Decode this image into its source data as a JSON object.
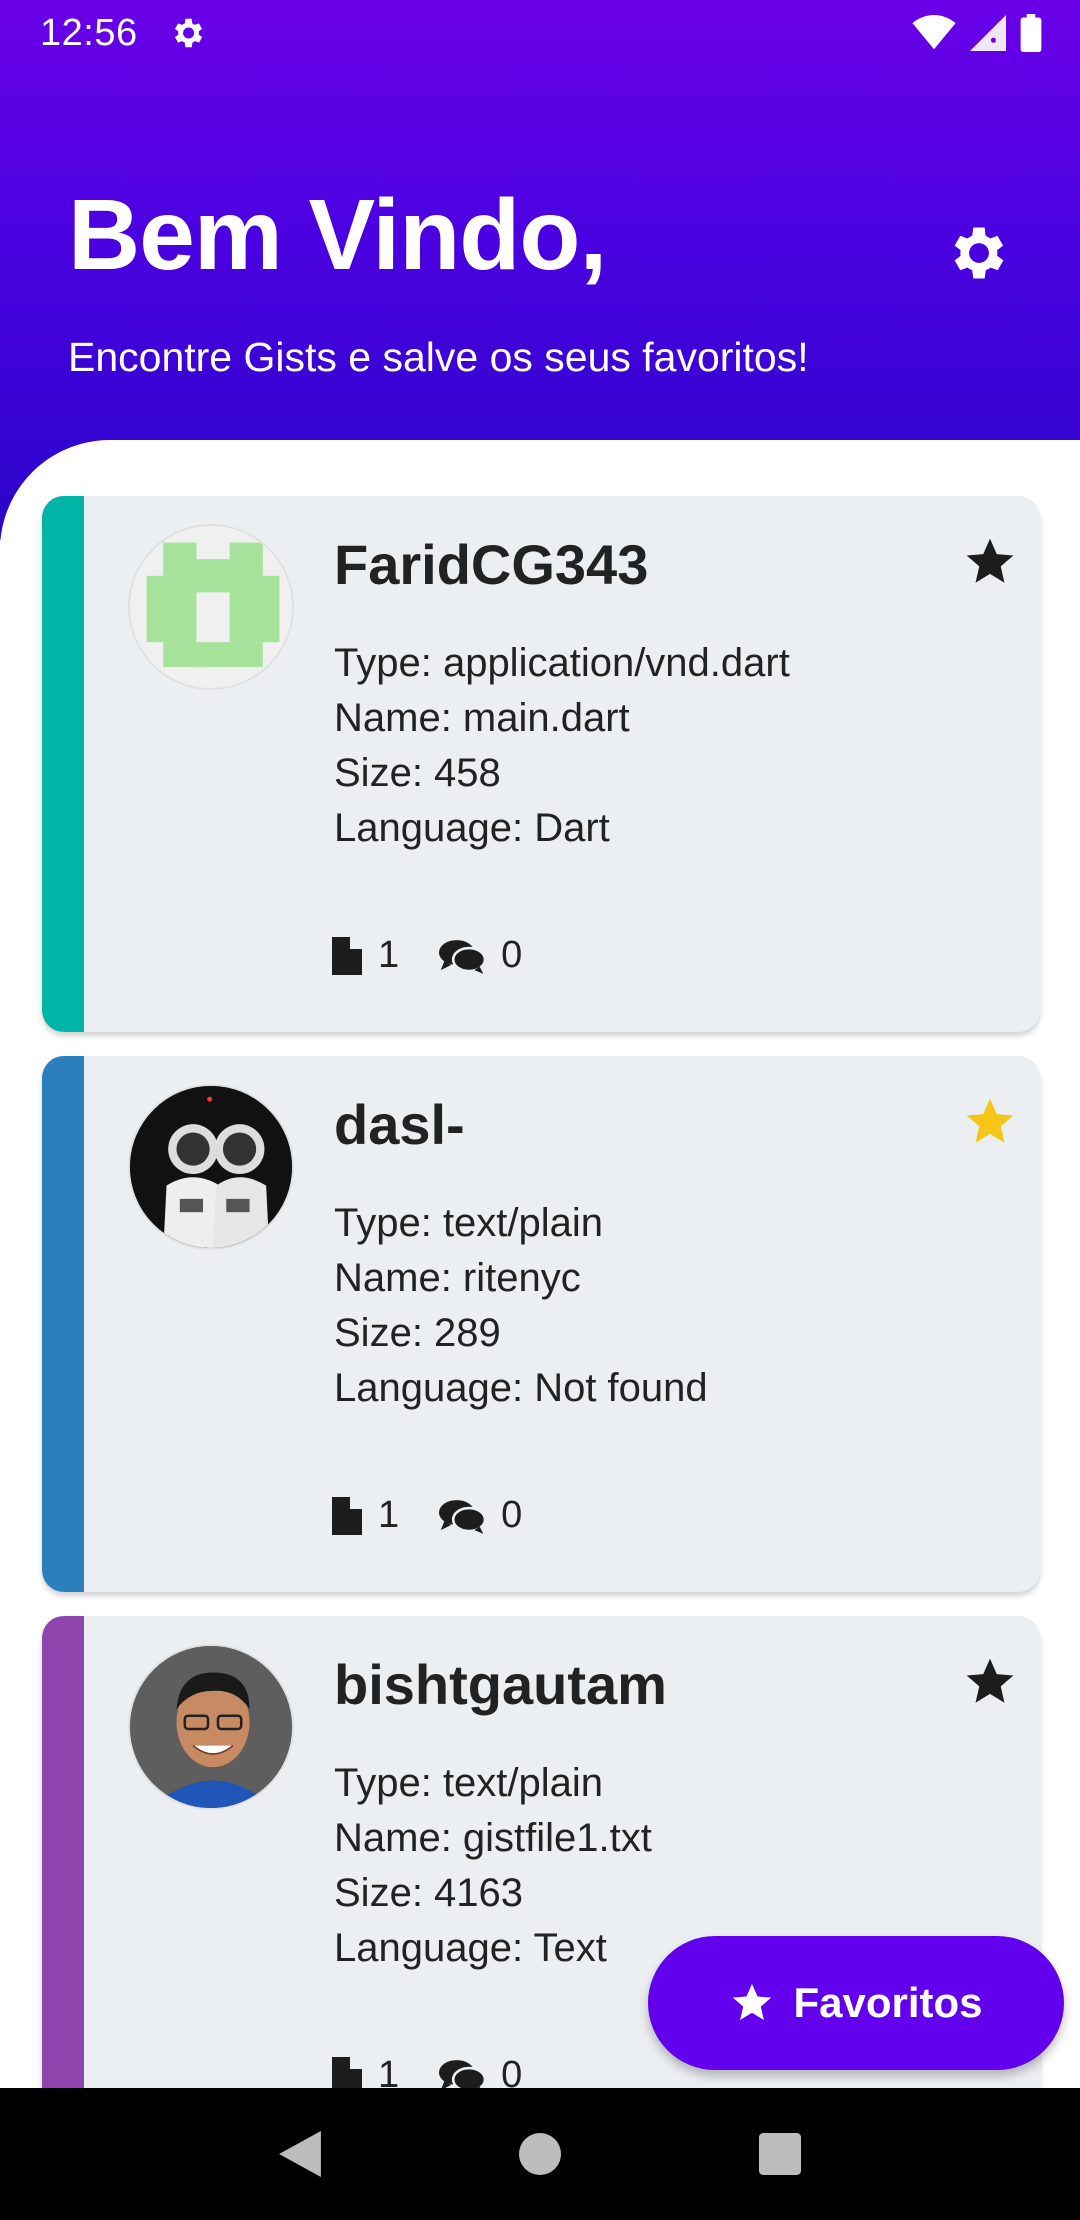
{
  "status_bar": {
    "time": "12:56",
    "icons": [
      "settings-icon",
      "wifi-icon",
      "signal-icon",
      "battery-icon"
    ]
  },
  "header": {
    "title": "Bem Vindo,",
    "subtitle": "Encontre Gists e salve os seus favoritos!",
    "settings_icon": "gear-icon"
  },
  "colors": {
    "header_top": "#6a00e8",
    "header_bottom": "#2a04c9",
    "card_background": "#eceff1",
    "favorite_star": "#f5c518",
    "fab": "#6200ee"
  },
  "gists": [
    {
      "username": "FaridCG343",
      "accent": "#00b4a6",
      "favorite": false,
      "type": "Type: application/vnd.dart",
      "name": "Name: main.dart",
      "size": "Size: 458",
      "language": "Language: Dart",
      "files": "1",
      "comments": "0"
    },
    {
      "username": "dasl-",
      "accent": "#2b7fbd",
      "favorite": true,
      "type": "Type: text/plain",
      "name": "Name: ritenyc",
      "size": "Size: 289",
      "language": "Language: Not found",
      "files": "1",
      "comments": "0"
    },
    {
      "username": "bishtgautam",
      "accent": "#8e44ad",
      "favorite": false,
      "type": "Type: text/plain",
      "name": "Name: gistfile1.txt",
      "size": "Size: 4163",
      "language": "Language: Text",
      "files": "1",
      "comments": "0"
    }
  ],
  "fab": {
    "label": "Favoritos",
    "icon": "star-icon"
  },
  "nav": {
    "back": "back-icon",
    "home": "home-icon",
    "recents": "recents-icon"
  }
}
